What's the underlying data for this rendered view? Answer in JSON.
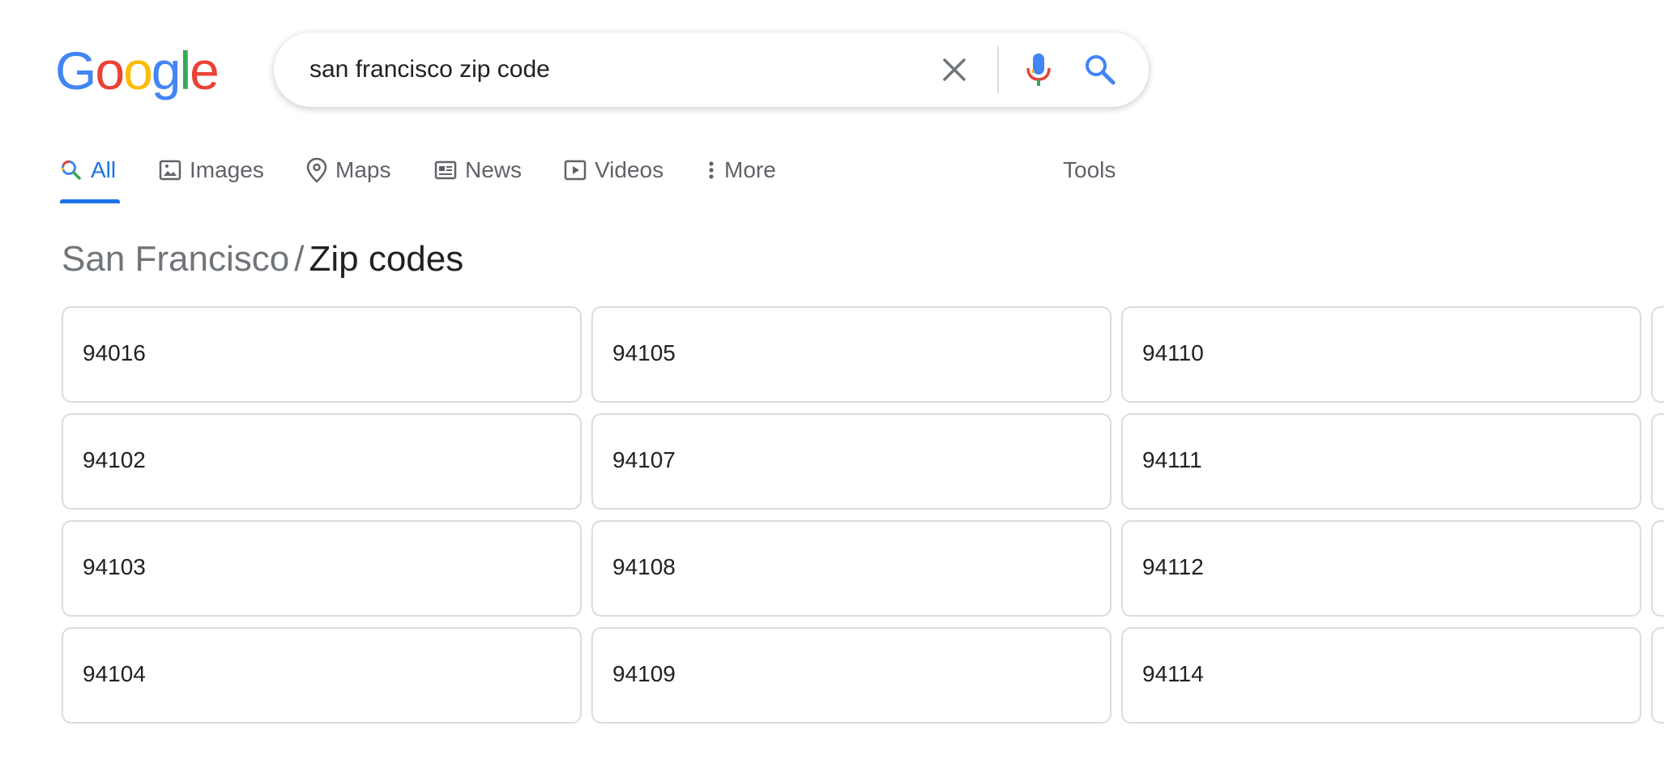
{
  "logo": {
    "letters": [
      {
        "char": "G",
        "color": "#4285F4"
      },
      {
        "char": "o",
        "color": "#EA4335"
      },
      {
        "char": "o",
        "color": "#FBBC05"
      },
      {
        "char": "g",
        "color": "#4285F4"
      },
      {
        "char": "l",
        "color": "#34A853"
      },
      {
        "char": "e",
        "color": "#EA4335"
      }
    ]
  },
  "search": {
    "query": "san francisco zip code",
    "icons": [
      "close-icon",
      "microphone-icon",
      "search-icon"
    ]
  },
  "tabs": [
    {
      "label": "All",
      "icon": "search-icon",
      "active": true
    },
    {
      "label": "Images",
      "icon": "image-icon"
    },
    {
      "label": "Maps",
      "icon": "map-pin-icon"
    },
    {
      "label": "News",
      "icon": "newspaper-icon"
    },
    {
      "label": "Videos",
      "icon": "play-icon"
    },
    {
      "label": "More",
      "icon": "more-vert-icon"
    }
  ],
  "tools_label": "Tools",
  "breadcrumb": {
    "parent": "San Francisco",
    "separator": "/",
    "current": "Zip codes"
  },
  "zip_codes": {
    "columns": [
      [
        "94016",
        "94102",
        "94103",
        "94104"
      ],
      [
        "94105",
        "94107",
        "94108",
        "94109"
      ],
      [
        "94110",
        "94111",
        "94112",
        "94114"
      ]
    ]
  },
  "colors": {
    "accent": "#1a73e8",
    "text": "#202124",
    "muted": "#5f6368",
    "border": "#dadce0"
  }
}
